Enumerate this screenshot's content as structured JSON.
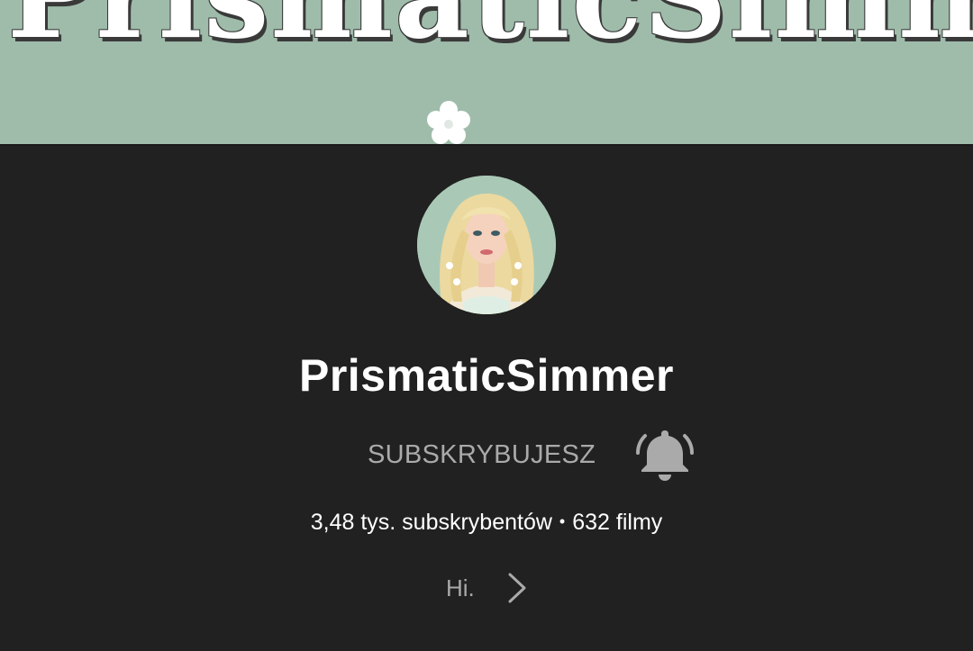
{
  "banner": {
    "title_art": "PrismaticSimmer",
    "background_color": "#9fbcaa",
    "icon": "flower-icon"
  },
  "channel": {
    "avatar_icon": "profile-avatar",
    "name": "PrismaticSimmer",
    "subscribe_label": "SUBSKRYBUJESZ",
    "bell_icon": "notification-bell-icon",
    "subscribers": "3,48 tys. subskrybentów",
    "separator": "•",
    "videos": "632 filmy",
    "description": "Hi.",
    "expand_icon": "chevron-right-icon"
  },
  "colors": {
    "background": "#212121",
    "text_primary": "#ffffff",
    "text_secondary": "#aaaaaa"
  }
}
